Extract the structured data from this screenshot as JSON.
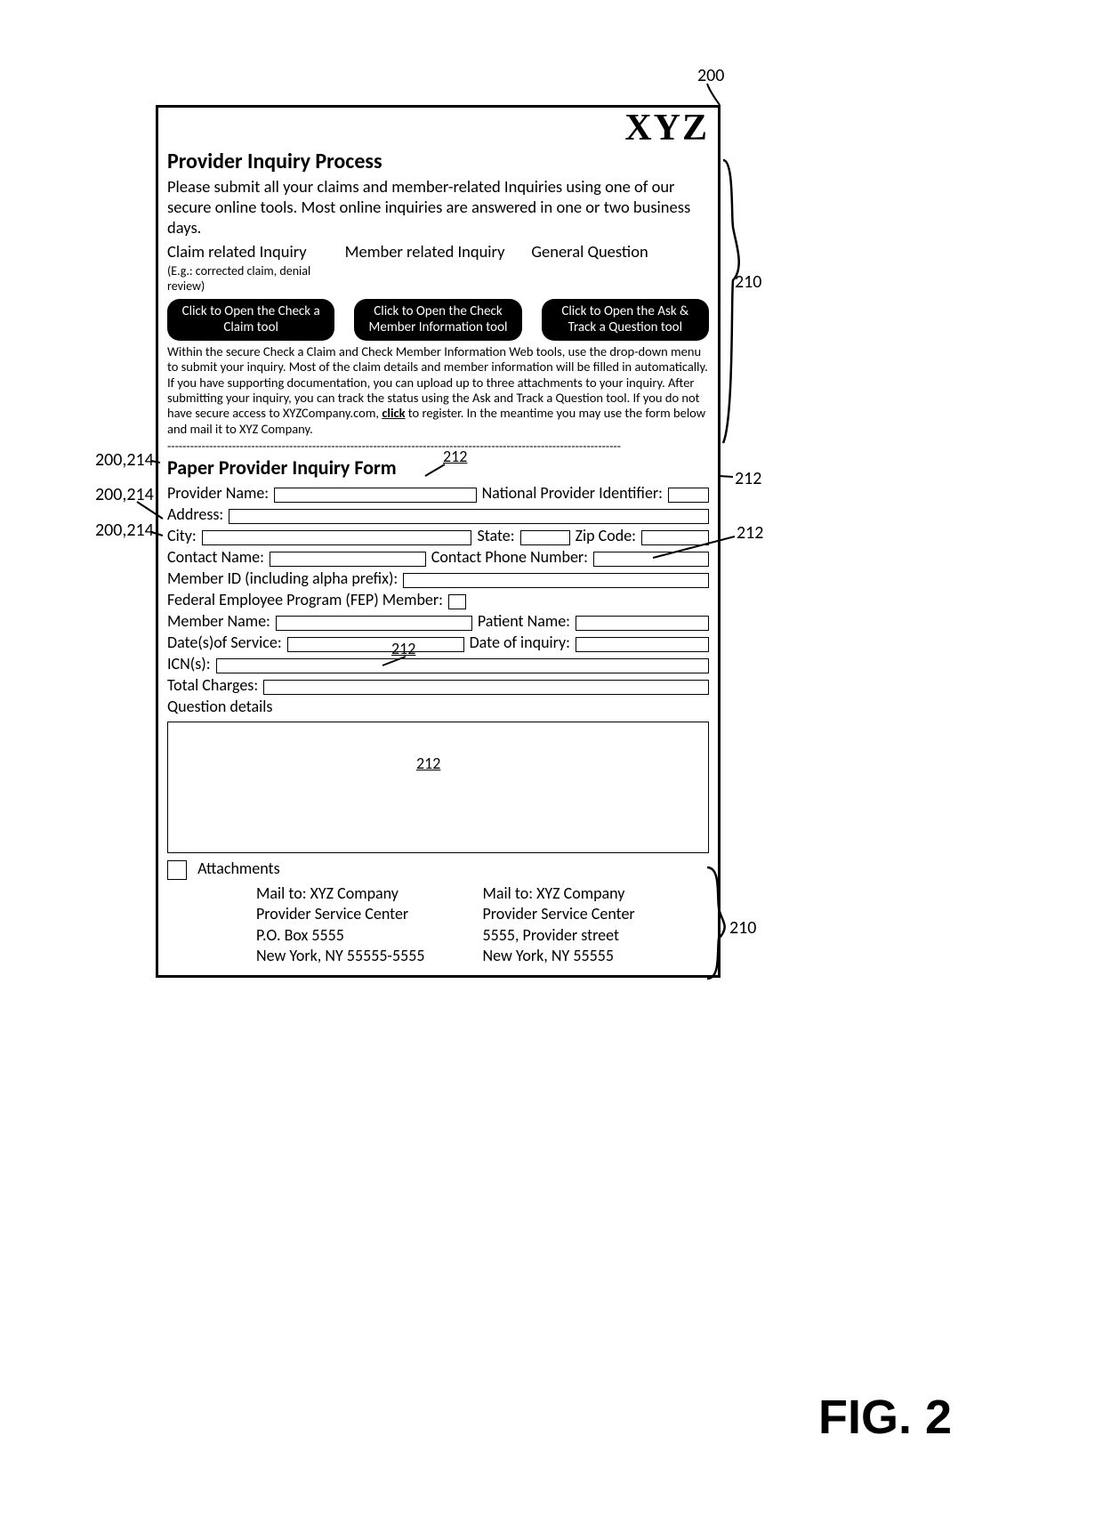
{
  "logo": "XYZ",
  "title": "Provider Inquiry Process",
  "intro": "Please submit all your claims and member-related Inquiries using one of our secure online tools.  Most online inquiries are answered in one or two business days.",
  "columns": {
    "claim": "Claim related Inquiry",
    "claim_eg": "(E.g.: corrected claim, denial review)",
    "member": "Member related Inquiry",
    "general": "General Question"
  },
  "buttons": {
    "claim": "Click to Open the Check a Claim tool",
    "member": "Click to Open the Check Member Information tool",
    "general": "Click to Open the Ask & Track a Question tool"
  },
  "info_pre": "Within the secure Check a Claim and Check Member Information Web tools, use the drop-down menu to submit your inquiry. Most of the claim details and member information will be filled in automatically. If you have supporting documentation, you can upload up to three attachments to your inquiry. After submitting your inquiry, you can track the status using the Ask and Track a Question tool. If you do not have secure access to XYZCompany.com, ",
  "info_click": "click",
  "info_post": " to register. In the meantime you may use the form below and mail it to XYZ Company.",
  "subtitle": "Paper Provider Inquiry Form",
  "labels": {
    "provider_name": "Provider Name:",
    "npi": "National Provider Identifier:",
    "address": "Address:",
    "city": "City:",
    "state": "State:",
    "zip": "Zip Code:",
    "contact_name": "Contact Name:",
    "contact_phone": "Contact Phone Number:",
    "member_id": "Member ID (including alpha prefix):",
    "fep": "Federal Employee Program (FEP) Member:",
    "member_name": "Member Name:",
    "patient_name": "Patient Name:",
    "dos": "Date(s)of Service:",
    "doi": "Date of inquiry:",
    "icn": "ICN(s):",
    "total": "Total Charges:",
    "qdetails": "Question details",
    "attachments": "Attachments"
  },
  "mail": {
    "a1": "Mail to: XYZ Company",
    "a2": "Provider Service Center",
    "a3": "P.O. Box 5555",
    "a4": "New York, NY 55555-5555",
    "b1": "Mail to: XYZ Company",
    "b2": "Provider Service Center",
    "b3": "5555, Provider street",
    "b4": "New York, NY 55555"
  },
  "refs": {
    "r200": "200",
    "r210": "210",
    "r212": "212",
    "r200_214": "200,214"
  },
  "fig": "FIG. 2"
}
